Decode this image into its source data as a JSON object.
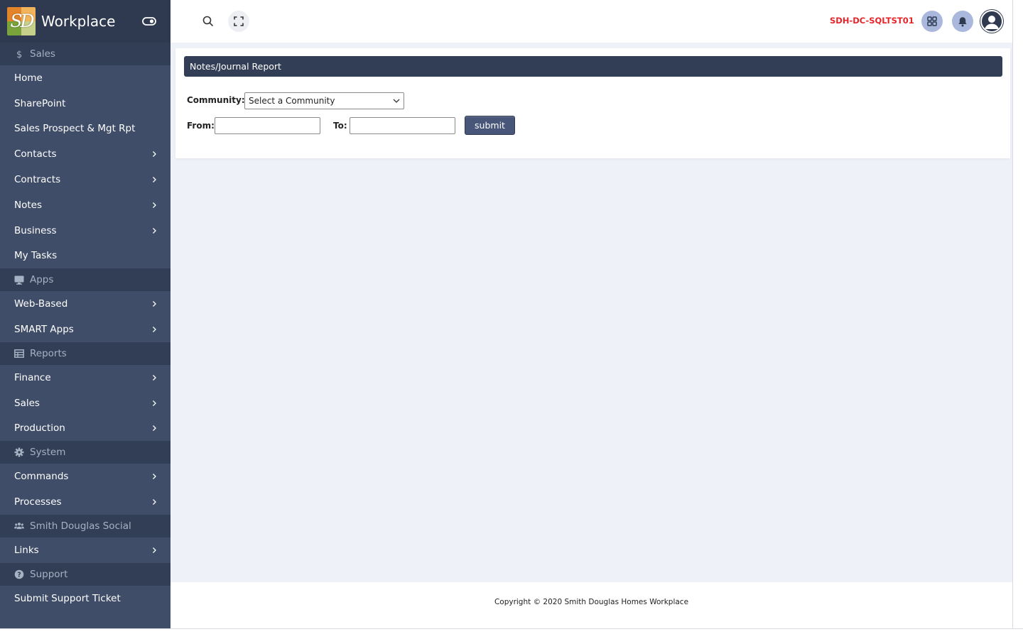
{
  "brand": {
    "logo_letters": "SD",
    "title": "Workplace"
  },
  "sidebar": {
    "sections": [
      {
        "label": "Sales",
        "icon": "dollar-icon",
        "items": [
          {
            "label": "Home",
            "has_children": false
          },
          {
            "label": "SharePoint",
            "has_children": false
          },
          {
            "label": "Sales Prospect & Mgt Rpt",
            "has_children": false
          },
          {
            "label": "Contacts",
            "has_children": true
          },
          {
            "label": "Contracts",
            "has_children": true
          },
          {
            "label": "Notes",
            "has_children": true
          },
          {
            "label": "Business",
            "has_children": true
          },
          {
            "label": "My Tasks",
            "has_children": false
          }
        ]
      },
      {
        "label": "Apps",
        "icon": "monitor-icon",
        "items": [
          {
            "label": "Web-Based",
            "has_children": true
          },
          {
            "label": "SMART Apps",
            "has_children": true
          }
        ]
      },
      {
        "label": "Reports",
        "icon": "table-icon",
        "items": [
          {
            "label": "Finance",
            "has_children": true
          },
          {
            "label": "Sales",
            "has_children": true
          },
          {
            "label": "Production",
            "has_children": true
          }
        ]
      },
      {
        "label": "System",
        "icon": "gear-icon",
        "items": [
          {
            "label": "Commands",
            "has_children": true
          },
          {
            "label": "Processes",
            "has_children": true
          }
        ]
      },
      {
        "label": "Smith Douglas Social",
        "icon": "users-icon",
        "items": [
          {
            "label": "Links",
            "has_children": true
          }
        ]
      },
      {
        "label": "Support",
        "icon": "question-icon",
        "items": [
          {
            "label": "Submit Support Ticket",
            "has_children": false
          }
        ]
      }
    ]
  },
  "header": {
    "server_name": "SDH-DC-SQLTST01",
    "server_color": "#e5252a"
  },
  "report": {
    "title": "Notes/Journal Report",
    "community_label": "Community:",
    "community_selected": "Select a Community",
    "from_label": "From:",
    "from_value": "",
    "to_label": "To:",
    "to_value": "",
    "submit_label": "submit"
  },
  "footer": {
    "copyright": "Copyright © 2020 Smith Douglas Homes Workplace"
  },
  "colors": {
    "sidebar_bg": "#3f4d68",
    "sidebar_section_bg": "#323e55",
    "accent_button": "#48567a",
    "header_circle": "#a9b8dc"
  }
}
